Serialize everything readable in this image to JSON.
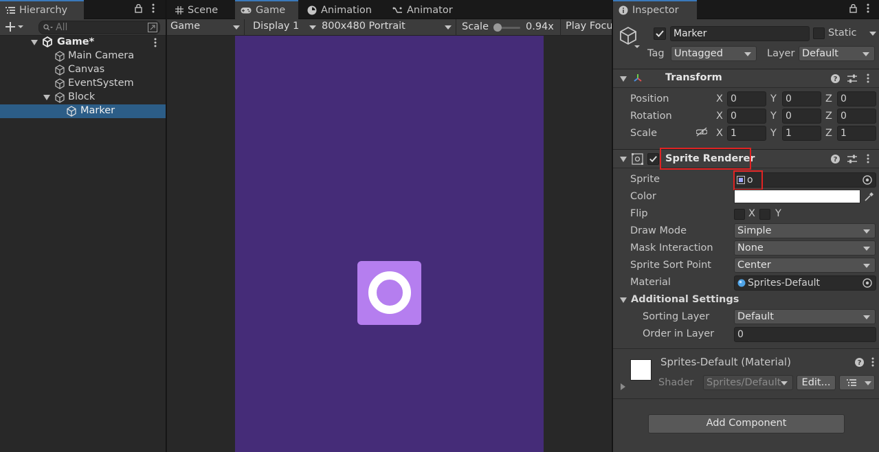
{
  "hierarchy": {
    "tab_label": "Hierarchy",
    "search_placeholder": "All",
    "items": [
      {
        "label": "Game*",
        "bold": true
      },
      {
        "label": "Main Camera"
      },
      {
        "label": "Canvas"
      },
      {
        "label": "EventSystem"
      },
      {
        "label": "Block"
      },
      {
        "label": "Marker",
        "selected": true
      }
    ]
  },
  "center": {
    "tabs": [
      "Scene",
      "Game",
      "Animation",
      "Animator"
    ],
    "toolbar": {
      "mode": "Game",
      "display": "Display 1",
      "resolution": "800x480 Portrait",
      "scale_label": "Scale",
      "scale_value": "0.94x",
      "play_focus": "Play Focu"
    },
    "game_colors": {
      "background": "#452c78",
      "square": "#b57eef",
      "ring": "#ffffff"
    }
  },
  "inspector": {
    "tab_label": "Inspector",
    "object_name": "Marker",
    "static_label": "Static",
    "tag_label": "Tag",
    "tag_value": "Untagged",
    "layer_label": "Layer",
    "layer_value": "Default",
    "transform": {
      "title": "Transform",
      "rows": [
        {
          "label": "Position",
          "x": "0",
          "y": "0",
          "z": "0"
        },
        {
          "label": "Rotation",
          "x": "0",
          "y": "0",
          "z": "0"
        },
        {
          "label": "Scale",
          "x": "1",
          "y": "1",
          "z": "1"
        }
      ],
      "axis_x": "X",
      "axis_y": "Y",
      "axis_z": "Z"
    },
    "sprite_renderer": {
      "title": "Sprite Renderer",
      "sprite_label": "Sprite",
      "sprite_value": "o",
      "color_label": "Color",
      "flip_label": "Flip",
      "flip_x": "X",
      "flip_y": "Y",
      "draw_mode_label": "Draw Mode",
      "draw_mode_value": "Simple",
      "mask_label": "Mask Interaction",
      "mask_value": "None",
      "sort_point_label": "Sprite Sort Point",
      "sort_point_value": "Center",
      "material_label": "Material",
      "material_value": "Sprites-Default",
      "additional_label": "Additional Settings",
      "sorting_layer_label": "Sorting Layer",
      "sorting_layer_value": "Default",
      "order_label": "Order in Layer",
      "order_value": "0"
    },
    "material": {
      "title": "Sprites-Default (Material)",
      "shader_label": "Shader",
      "shader_value": "Sprites/Default",
      "edit_label": "Edit..."
    },
    "add_component": "Add Component"
  }
}
